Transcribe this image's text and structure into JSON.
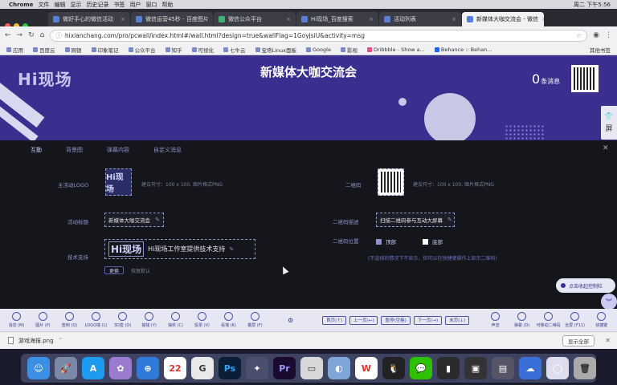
{
  "menubar": {
    "app": "Chrome",
    "items": [
      "文件",
      "编辑",
      "显示",
      "历史记录",
      "书签",
      "用户",
      "窗口",
      "帮助"
    ],
    "status": "周二 下午5:56"
  },
  "tabs": [
    {
      "label": "做好手心的微信活动",
      "active": false
    },
    {
      "label": "微信运营45秒 - 百度图片",
      "active": false
    },
    {
      "label": "微信公众平台",
      "active": false
    },
    {
      "label": "Hi现场_百度搜索",
      "active": false
    },
    {
      "label": "活动列表",
      "active": false
    },
    {
      "label": "新媒体大咖交流会 - 微信",
      "active": true
    }
  ],
  "address": {
    "url": "hixianchang.com/pro/pcwall/index.html#/wall.html?design=true&wallFlag=1GoyjsiU&activity=msg"
  },
  "bookmarks": [
    "应用",
    "百度云",
    "网银",
    "印象笔记",
    "公众平台",
    "知乎",
    "可视化",
    "七牛云",
    "宝塔Linux面板",
    "Google",
    "影视",
    "Dribbble - Show a...",
    "Behance :: Behan..."
  ],
  "bookmarks_other": "其他书签",
  "banner": {
    "logo": "Hi现场",
    "title": "新媒体大咖交流会",
    "msg_count": "0",
    "msg_unit": "条消息",
    "side_label": "屏"
  },
  "panel": {
    "tabs": [
      "互動",
      "背景图",
      "弹幕内容",
      "自定义消息"
    ],
    "logo_label": "主活动LOGO",
    "logo_placeholder": "Hi现场",
    "logo_hint": "建议尺寸：100 x 100, 图片格式PNG",
    "qr_label": "二维码",
    "qr_hint": "建议尺寸：100 x 100, 图片格式PNG",
    "title_label": "活动标题",
    "title_value": "新媒体大咖交流会",
    "qr_text_label": "二维码描述",
    "qr_text_value": "扫描二维码参与互动大屏幕",
    "qr_pos_label": "二维码位置",
    "qr_pos_options": [
      "顶部",
      "底部"
    ],
    "note": "(不选择的情况下不显示，但可以在快捷键操作上显示二维码)",
    "tech_label": "技术支持",
    "tech_logo": "Hi现场",
    "tech_text": "Hi现场工作室提供技术支持",
    "change_btn": "更换",
    "restore_btn": "恢复默认"
  },
  "float_btn": "点击收起控制栏",
  "controls": [
    "消息 (M)",
    "图片 (P)",
    "签到 (Q)",
    "LOGO墙 (L)",
    "3D签 (D)",
    "摇钱 (Y)",
    "抽奖 (C)",
    "投票 (V)",
    "看墙 (K)",
    "霸屏 (F)"
  ],
  "controls_right": [
    "声音",
    "弹幕 (D)",
    "可移动二维码",
    "全屏 (F11)",
    "快捷键"
  ],
  "nav": [
    "首页(↑)",
    "上一页(←)",
    "暂停(空格)",
    "下一页(→)",
    "末页(↓)"
  ],
  "download": {
    "file": "游戏海报.png",
    "show_all": "显示全部"
  }
}
